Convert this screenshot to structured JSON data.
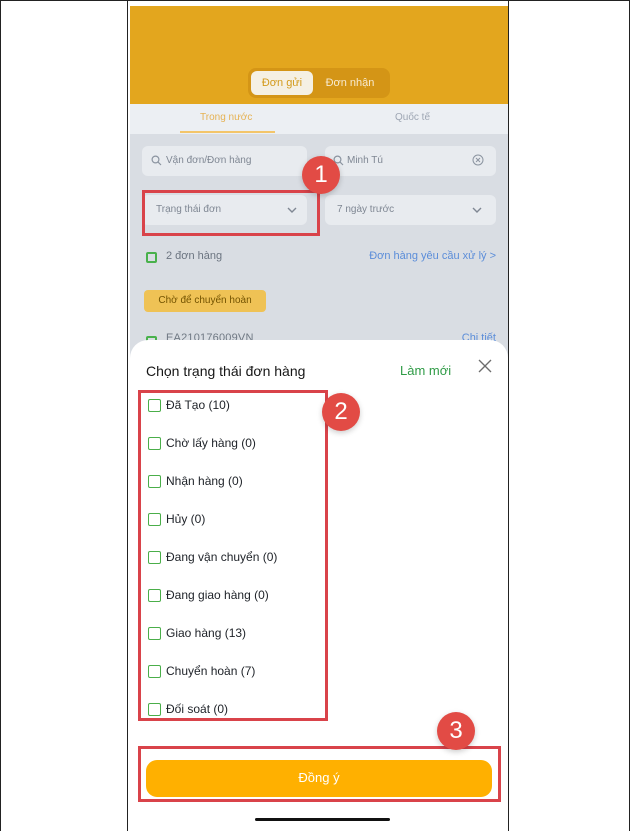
{
  "top_tabs": {
    "active": "Đơn gửi",
    "inactive": "Đơn nhận"
  },
  "sub_tabs": {
    "active": "Trong nước",
    "inactive": "Quốc tế"
  },
  "filters": {
    "search_placeholder": "Vận đơn/Đơn hàng",
    "person_value": "Minh Tú",
    "status_label": "Trạng thái đơn",
    "date_label": "7 ngày trước"
  },
  "summary": {
    "order_count": "2 đơn hàng",
    "request_link": "Đơn hàng yêu cầu xử lý >"
  },
  "chip": {
    "label": "Chờ để chuyển hoàn"
  },
  "order": {
    "id": "EA210176009VN",
    "detail": "Chi tiết"
  },
  "sheet": {
    "title": "Chọn trạng thái đơn hàng",
    "refresh": "Làm mới",
    "items": [
      "Đã Tạo (10)",
      "Chờ lấy hàng (0)",
      "Nhận hàng (0)",
      "Hủy (0)",
      "Đang vận chuyển (0)",
      "Đang giao hàng (0)",
      "Giao hàng (13)",
      "Chuyển hoàn (7)",
      "Đối soát (0)"
    ],
    "confirm": "Đồng ý"
  },
  "badges": [
    "1",
    "2",
    "3"
  ],
  "colors": {
    "accent": "#e3a61e",
    "confirm": "#ffb000",
    "green": "#4aae49",
    "red": "#d9434a"
  }
}
